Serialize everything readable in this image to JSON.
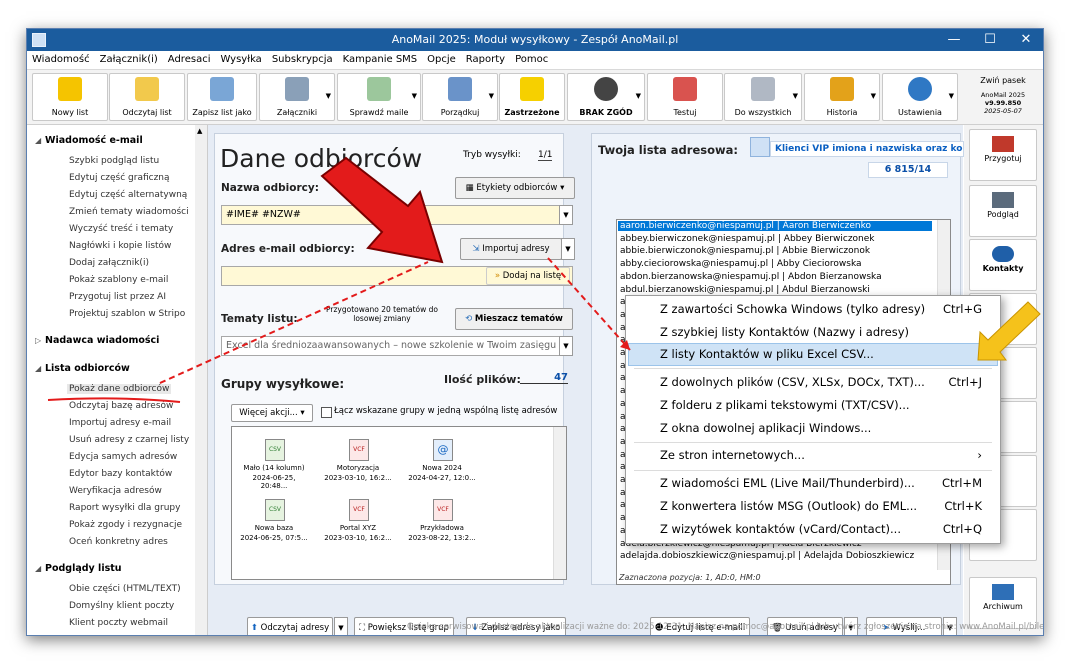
{
  "window": {
    "title": "AnoMail 2025: Moduł wysyłkowy - Zespół AnoMail.pl"
  },
  "menu": [
    "Wiadomość",
    "Załącznik(i)",
    "Adresaci",
    "Wysyłka",
    "Subskrypcja",
    "Kampanie SMS",
    "Opcje",
    "Raporty",
    "Pomoc"
  ],
  "toolbar": {
    "buttons": [
      "Nowy list",
      "Odczytaj list",
      "Zapisz list jako",
      "Załączniki",
      "Sprawdź maile",
      "Porządkuj",
      "Zastrzeżone",
      "BRAK ZGÓD",
      "Testuj",
      "Do wszystkich",
      "Historia",
      "Ustawienia"
    ],
    "collapse": "Zwiń pasek",
    "version": [
      "AnoMail 2025",
      "v9.99.850",
      "2025-05-07"
    ]
  },
  "sidebar": {
    "sections": [
      {
        "title": "Wiadomość e-mail",
        "items": [
          "Szybki podgląd listu",
          "Edytuj część graficzną",
          "Edytuj część alternatywną",
          "Zmień tematy wiadomości",
          "Wyczyść treść i tematy",
          "Nagłówki i kopie listów",
          "Dodaj załącznik(i)",
          "Pokaż szablony e-mail",
          "Przygotuj list przez AI",
          "Projektuj szablon w Stripo"
        ]
      },
      {
        "title": "Nadawca wiadomości",
        "items": []
      },
      {
        "title": "Lista odbiorców",
        "items": [
          "Pokaż dane odbiorców",
          "Odczytaj bazę adresów",
          "Importuj adresy e-mail",
          "Usuń adresy z czarnej listy",
          "Edycja samych adresów",
          "Edytor bazy kontaktów",
          "Weryfikacja adresów",
          "Raport wysyłki dla grupy",
          "Pokaż zgody i rezygnacje",
          "Oceń konkretny adres"
        ]
      },
      {
        "title": "Podglądy listu",
        "items": [
          "Obie części (HTML/TEXT)",
          "Domyślny klient poczty",
          "Klient poczty webmail"
        ]
      }
    ]
  },
  "main": {
    "heading": "Dane odbiorców",
    "tryb_label": "Tryb wysyłki:",
    "tryb_value": "1/1",
    "nazwa_label": "Nazwa odbiorcy:",
    "etykiety_btn": "Etykiety odbiorców",
    "nazwa_value": "#IME# #NZW#",
    "adres_label": "Adres e-mail odbiorcy:",
    "importuj_btn": "Importuj adresy",
    "dodaj_btn": "Dodaj na listę",
    "tematy_label": "Tematy listu:",
    "tematy_info": "Przygotowano 20 tematów do losowej zmiany",
    "mieszacz_btn": "Mieszacz tematów",
    "temat_value": "Excel dla średniozaawansowanych – nowe szkolenie w Twoim zasięgu",
    "grupy_label": "Grupy wysyłkowe:",
    "ilosc_label": "Ilość plików:",
    "ilosc_value": "47",
    "wiecej_btn": "Więcej akcji...",
    "lacz_label": "Łącz wskazane grupy w jedną wspólną listę adresów",
    "files": [
      {
        "type": "CSV",
        "name": "Mało (14 kolumn)",
        "date": "2024-06-25, 20:48..."
      },
      {
        "type": "VCF",
        "name": "Motoryzacja",
        "date": "2023-03-10, 16:2..."
      },
      {
        "type": "@",
        "name": "Nowa 2024",
        "date": "2024-04-27, 12:0..."
      },
      {
        "type": "CSV",
        "name": "Nowa baza",
        "date": "2024-06-25, 07:5..."
      },
      {
        "type": "VCF",
        "name": "Portal XYZ",
        "date": "2023-03-10, 16:2..."
      },
      {
        "type": "VCF",
        "name": "Przykładowa",
        "date": "2023-08-22, 13:2..."
      }
    ],
    "lista_label": "Twoja lista adresowa:",
    "vip_link": "Klienci VIP imiona i nazwiska oraz kody",
    "count": "6 815/14",
    "addresses": [
      "aaron.bierwiczenko@niespamuj.pl | Aaron Bierwiczenko",
      "abbey.bierwiczonek@niespamuj.pl | Abbey Bierwiczonek",
      "abbie.bierwiczonok@niespamuj.pl | Abbie Bierwiczonok",
      "abby.cieciorowska@niespamuj.pl | Abby Cieciorowska",
      "abdon.bierzanowska@niespamuj.pl | Abdon Bierzanowska",
      "abdul.bierzanowski@niespamuj.pl | Abdul Bierzanowski",
      "abe.delengiewicz@niespamuj.pl | Abe Delengiewicz",
      "abel.cieciorowski@niespamuj.pl | Abel Cieciorowski",
      "abelard",
      "abigail.",
      "abraha",
      "abram.",
      "achacju",
      "achacy.",
      "achilles",
      "ada.del",
      "adalbert",
      "adalber",
      "adam.b",
      "adam.c",
      "adamin",
      "adas.de",
      "adas.ci",
      "addie.b",
      "adek.cl",
      "adela.bierzkiewicz@niespamuj.pl | Adela Bierzkiewicz",
      "adelajda.dobioszkiewicz@niespamuj.pl | Adelajda Dobioszkiewicz"
    ],
    "status_line": "Zaznaczona pozycja:  1,  AD:0, HM:0",
    "bottom_buttons": [
      "Odczytaj adresy",
      "Powiększ listę grup",
      "Zapisz adresy jako",
      "Edytuj listę e-maili",
      "Usuń adresy",
      "Wyślij..."
    ]
  },
  "context_menu": [
    {
      "label": "Z zawartości Schowka Windows (tylko adresy)",
      "shortcut": "Ctrl+G"
    },
    {
      "label": "Z szybkiej listy Kontaktów (Nazwy i adresy)",
      "shortcut": ""
    },
    {
      "label": "Z listy Kontaktów w pliku Excel CSV...",
      "shortcut": ""
    },
    {
      "label": "Z dowolnych plików (CSV, XLSx, DOCx, TXT)...",
      "shortcut": "Ctrl+J"
    },
    {
      "label": "Z folderu z plikami tekstowymi (TXT/CSV)...",
      "shortcut": ""
    },
    {
      "label": "Z okna dowolnej aplikacji Windows...",
      "shortcut": ""
    },
    {
      "label": "Ze stron internetowych...",
      "shortcut": "›"
    },
    {
      "label": "Z wiadomości EML (Live Mail/Thunderbird)...",
      "shortcut": "Ctrl+M"
    },
    {
      "label": "Z konwertera listów MSG (Outlook) do EML...",
      "shortcut": "Ctrl+K"
    },
    {
      "label": "Z wizytówek kontaktów (vCard/Contact)...",
      "shortcut": "Ctrl+Q"
    }
  ],
  "right_panel": [
    "Przygotuj",
    "Podgląd",
    "Kontakty",
    "Archiwum"
  ],
  "status_bar": "Opieka serwisowa i dostęp do aktualizacji ważne do: 2025-12-31. Napisz na pomoc@anomail.pl lub utwórz zgłoszenie na stronie: www.AnoMail.pl/bilet",
  "colors": {
    "titlebar": "#1b5c9e",
    "selection": "#cce4f7",
    "menu_highlight": "#cfe3f6",
    "link": "#0a5fc2",
    "arrow": "#e31b1b"
  }
}
